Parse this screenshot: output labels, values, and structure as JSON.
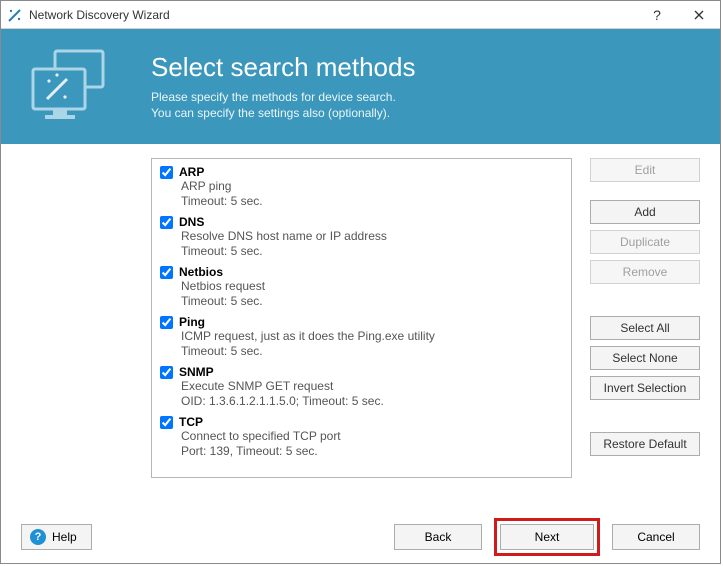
{
  "window": {
    "title": "Network Discovery Wizard"
  },
  "banner": {
    "heading": "Select search methods",
    "sub1": "Please specify the methods for device search.",
    "sub2": "You can specify the settings also (optionally)."
  },
  "methods": [
    {
      "checked": true,
      "name": "ARP",
      "desc": "ARP ping",
      "meta": "Timeout: 5 sec."
    },
    {
      "checked": true,
      "name": "DNS",
      "desc": "Resolve DNS host name or IP address",
      "meta": "Timeout: 5 sec."
    },
    {
      "checked": true,
      "name": "Netbios",
      "desc": "Netbios request",
      "meta": "Timeout: 5 sec."
    },
    {
      "checked": true,
      "name": "Ping",
      "desc": "ICMP request, just as it does the Ping.exe utility",
      "meta": "Timeout: 5 sec."
    },
    {
      "checked": true,
      "name": "SNMP",
      "desc": "Execute SNMP GET request",
      "meta": "OID: 1.3.6.1.2.1.1.5.0; Timeout: 5 sec."
    },
    {
      "checked": true,
      "name": "TCP",
      "desc": "Connect to specified TCP port",
      "meta": "Port: 139, Timeout: 5 sec."
    }
  ],
  "side": {
    "edit": "Edit",
    "add": "Add",
    "duplicate": "Duplicate",
    "remove": "Remove",
    "select_all": "Select All",
    "select_none": "Select None",
    "invert": "Invert Selection",
    "restore": "Restore Default"
  },
  "footer": {
    "help": "Help",
    "back": "Back",
    "next": "Next",
    "cancel": "Cancel"
  }
}
